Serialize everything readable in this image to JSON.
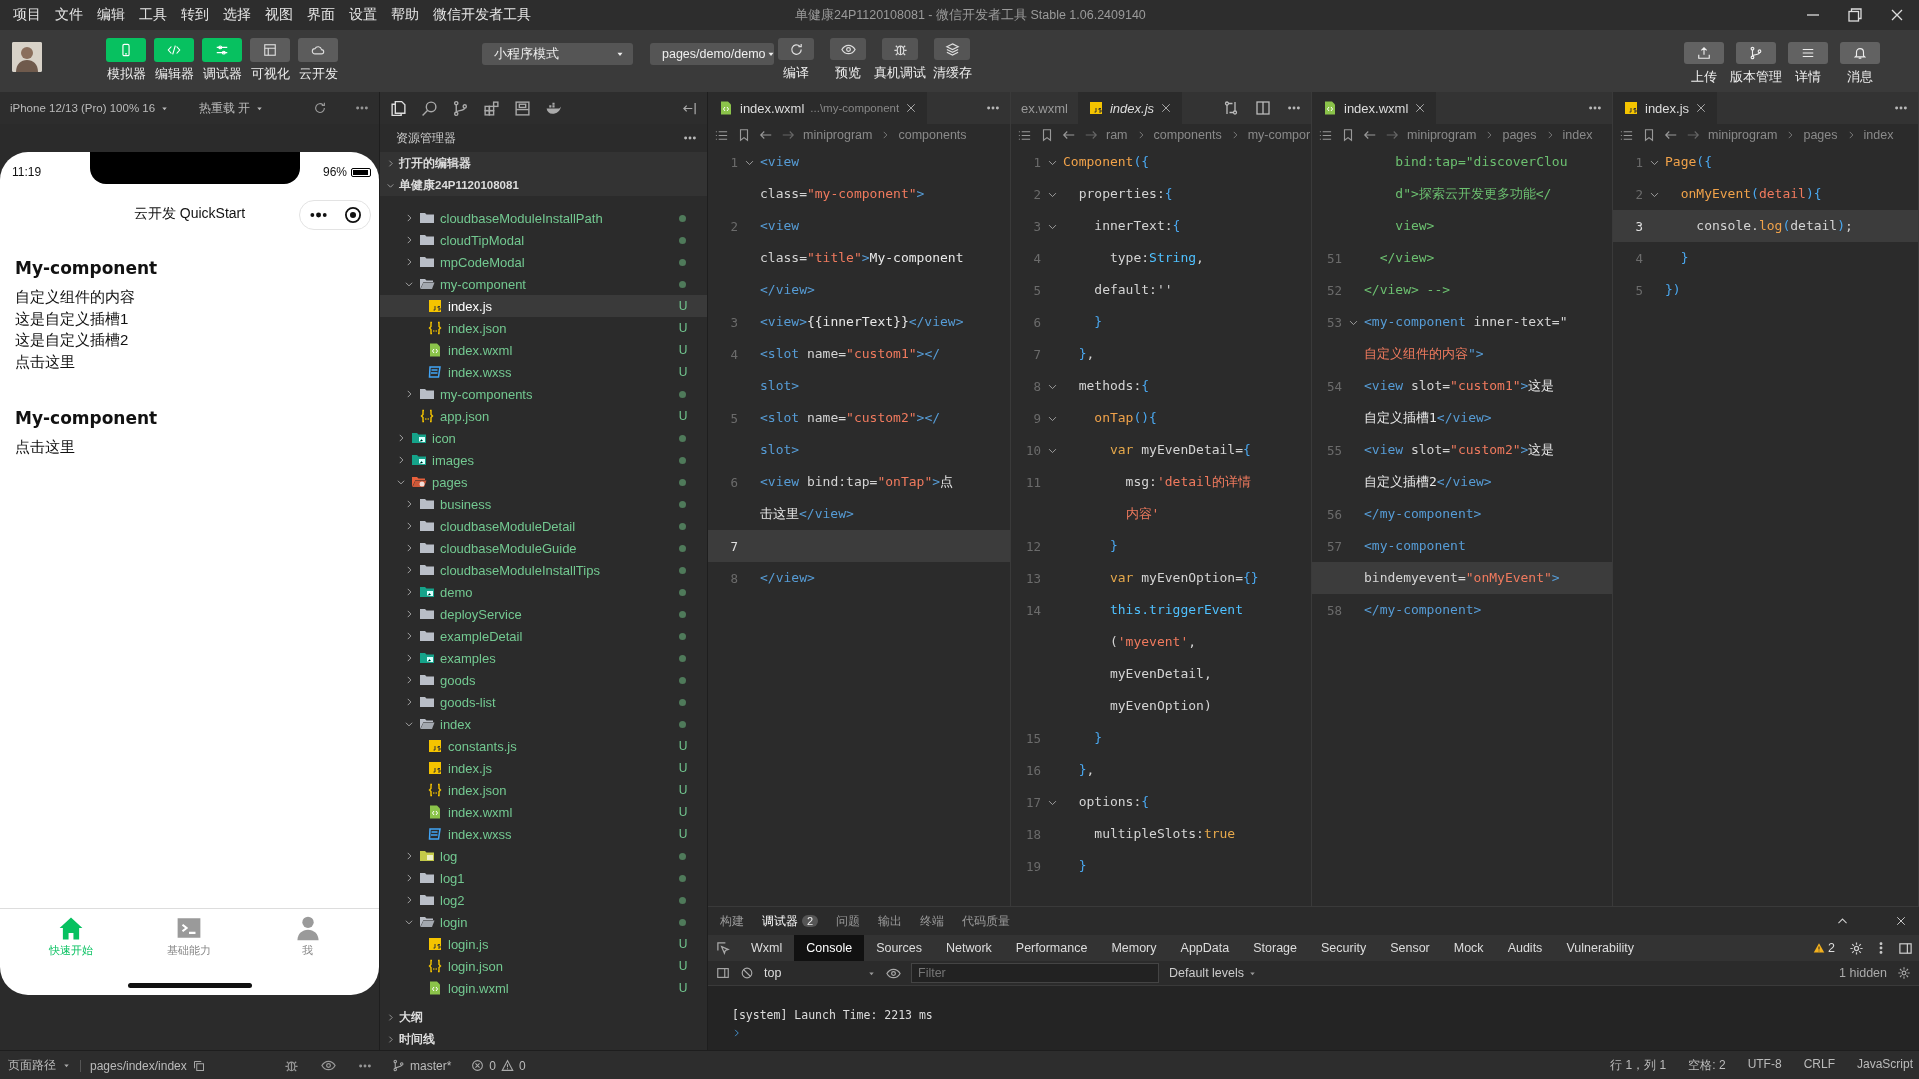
{
  "menu": [
    "项目",
    "文件",
    "编辑",
    "工具",
    "转到",
    "选择",
    "视图",
    "界面",
    "设置",
    "帮助",
    "微信开发者工具"
  ],
  "window": {
    "title": "单健康24P1120108081 - 微信开发者工具 Stable 1.06.2409140"
  },
  "toolbar": {
    "view_buttons": [
      {
        "label": "模拟器",
        "kind": "phone",
        "on": true
      },
      {
        "label": "编辑器",
        "kind": "code",
        "on": true
      },
      {
        "label": "调试器",
        "kind": "sliders",
        "on": true
      },
      {
        "label": "可视化",
        "kind": "layout",
        "on": false
      },
      {
        "label": "云开发",
        "kind": "cloud",
        "on": false
      }
    ],
    "mode": "小程序模式",
    "compile_page": "pages/demo/demo",
    "actions": [
      {
        "label": "编译",
        "kind": "refresh"
      },
      {
        "label": "预览",
        "kind": "eye"
      },
      {
        "label": "真机调试",
        "kind": "bug"
      },
      {
        "label": "清缓存",
        "kind": "layers"
      }
    ],
    "right_buttons": [
      {
        "label": "上传",
        "kind": "upload"
      },
      {
        "label": "版本管理",
        "kind": "branch"
      },
      {
        "label": "详情",
        "kind": "menu"
      },
      {
        "label": "消息",
        "kind": "bell"
      }
    ]
  },
  "simulator": {
    "device": "iPhone 12/13 (Pro) 100% 16",
    "hot_reload": "热重载 开",
    "time": "11:19",
    "battery": "96%",
    "nav_title": "云开发 QuickStart",
    "blocks": [
      {
        "heading": "My-component",
        "lines": [
          "自定义组件的内容",
          "这是自定义插槽1",
          "这是自定义插槽2",
          "点击这里"
        ]
      },
      {
        "heading": "My-component",
        "lines": [
          "点击这里"
        ]
      }
    ],
    "tabbar": [
      {
        "label": "快速开始",
        "kind": "home",
        "selected": true
      },
      {
        "label": "基础能力",
        "kind": "terminal",
        "selected": false
      },
      {
        "label": "我",
        "kind": "person",
        "selected": false
      }
    ]
  },
  "explorer": {
    "title": "资源管理器",
    "sections": [
      {
        "label": "打开的编辑器",
        "expanded": false
      },
      {
        "label": "单健康24P1120108081",
        "expanded": true
      }
    ],
    "tree": [
      {
        "children": [
          {
            "label": "cloudbaseModuleInstallPath",
            "kind": "folder",
            "expanded": false,
            "selected": false
          },
          {
            "label": "cloudTipModal",
            "kind": "folder",
            "expanded": false,
            "selected": false
          },
          {
            "label": "mpCodeModal",
            "kind": "folder",
            "expanded": false,
            "selected": false
          },
          {
            "label": "my-component",
            "kind": "folder",
            "expanded": true,
            "selected": false,
            "children": [
              {
                "label": "index.js",
                "kind": "js",
                "badge": "U",
                "selected": true
              },
              {
                "label": "index.json",
                "kind": "json",
                "badge": "U",
                "selected": false
              },
              {
                "label": "index.wxml",
                "kind": "wxml",
                "badge": "U",
                "selected": false
              },
              {
                "label": "index.wxss",
                "kind": "wxss",
                "badge": "U",
                "selected": false
              }
            ]
          },
          {
            "label": "my-components",
            "kind": "folder",
            "expanded": false,
            "selected": false
          },
          {
            "label": "app.json",
            "kind": "json",
            "badge": "U",
            "selected": false
          }
        ]
      },
      {
        "label": "icon",
        "kind": "folder-image",
        "expanded": false,
        "selected": false
      },
      {
        "label": "images",
        "kind": "folder-image",
        "expanded": false,
        "selected": false
      },
      {
        "label": "pages",
        "kind": "folder-pages",
        "expanded": true,
        "selected": false,
        "children": [
          {
            "label": "business",
            "kind": "folder",
            "expanded": false,
            "selected": false
          },
          {
            "label": "cloudbaseModuleDetail",
            "kind": "folder",
            "expanded": false,
            "selected": false
          },
          {
            "label": "cloudbaseModuleGuide",
            "kind": "folder",
            "expanded": false,
            "selected": false
          },
          {
            "label": "cloudbaseModuleInstallTips",
            "kind": "folder",
            "expanded": false,
            "selected": false
          },
          {
            "label": "demo",
            "kind": "folder-image",
            "expanded": false,
            "selected": false
          },
          {
            "label": "deployService",
            "kind": "folder",
            "expanded": false,
            "selected": false
          },
          {
            "label": "exampleDetail",
            "kind": "folder",
            "expanded": false,
            "selected": false
          },
          {
            "label": "examples",
            "kind": "folder-image",
            "expanded": false,
            "selected": false
          },
          {
            "label": "goods",
            "kind": "folder",
            "expanded": false,
            "selected": false
          },
          {
            "label": "goods-list",
            "kind": "folder",
            "expanded": false,
            "selected": false
          },
          {
            "label": "index",
            "kind": "folder",
            "expanded": true,
            "selected": false,
            "children": [
              {
                "label": "constants.js",
                "kind": "js",
                "badge": "U",
                "selected": false
              },
              {
                "label": "index.js",
                "kind": "js",
                "badge": "U",
                "selected": false
              },
              {
                "label": "index.json",
                "kind": "json",
                "badge": "U",
                "selected": false
              },
              {
                "label": "index.wxml",
                "kind": "wxml",
                "badge": "U",
                "selected": false
              },
              {
                "label": "index.wxss",
                "kind": "wxss",
                "badge": "U",
                "selected": false
              }
            ]
          },
          {
            "label": "log",
            "kind": "folder-log",
            "expanded": false,
            "selected": false
          },
          {
            "label": "log1",
            "kind": "folder",
            "expanded": false,
            "selected": false
          },
          {
            "label": "log2",
            "kind": "folder",
            "expanded": false,
            "selected": false
          },
          {
            "label": "login",
            "kind": "folder",
            "expanded": true,
            "selected": false,
            "children": [
              {
                "label": "login.js",
                "kind": "js",
                "badge": "U",
                "selected": false
              },
              {
                "label": "login.json",
                "kind": "json",
                "badge": "U",
                "selected": false
              },
              {
                "label": "login.wxml",
                "kind": "wxml",
                "badge": "U",
                "selected": false
              }
            ]
          }
        ]
      }
    ],
    "bottom_sections": [
      {
        "label": "大纲",
        "expanded": false
      },
      {
        "label": "时间线",
        "expanded": false
      }
    ]
  },
  "editors": [
    {
      "focused": false,
      "tabs": [
        {
          "label": "index.wxml",
          "description": "...\\my-component",
          "kind": "wxml",
          "selected": true,
          "preview": false
        }
      ],
      "breadcrumb": [
        "miniprogram",
        "components"
      ],
      "rows": [
        {
          "number": "1",
          "fold": true,
          "tokens": [
            {
              "kind": "tag",
              "text": "<view"
            }
          ]
        },
        {
          "tokens": [
            {
              "kind": "attr",
              "text": "class="
            },
            {
              "kind": "string",
              "text": "\"my-component\""
            },
            {
              "kind": "tag",
              "text": ">"
            }
          ]
        },
        {
          "number": "2",
          "tokens": [
            {
              "kind": "tag",
              "text": "<view"
            }
          ]
        },
        {
          "tokens": [
            {
              "kind": "attr",
              "text": "class="
            },
            {
              "kind": "string",
              "text": "\"title\""
            },
            {
              "kind": "tag",
              "text": ">"
            },
            {
              "kind": "text",
              "text": "My-component"
            }
          ]
        },
        {
          "tokens": [
            {
              "kind": "tag",
              "text": "</view>"
            }
          ]
        },
        {
          "number": "3",
          "tokens": [
            {
              "kind": "tag",
              "text": "<view>"
            },
            {
              "kind": "text",
              "text": "{{innerText}}"
            },
            {
              "kind": "tag",
              "text": "</view>"
            }
          ]
        },
        {
          "number": "4",
          "tokens": [
            {
              "kind": "tag",
              "text": "<slot"
            },
            {
              "kind": "attr",
              "text": " name="
            },
            {
              "kind": "string",
              "text": "\"custom1\""
            },
            {
              "kind": "tag",
              "text": "></"
            }
          ]
        },
        {
          "tokens": [
            {
              "kind": "tag",
              "text": "slot>"
            }
          ]
        },
        {
          "number": "5",
          "tokens": [
            {
              "kind": "tag",
              "text": "<slot"
            },
            {
              "kind": "attr",
              "text": " name="
            },
            {
              "kind": "string",
              "text": "\"custom2\""
            },
            {
              "kind": "tag",
              "text": "></"
            }
          ]
        },
        {
          "tokens": [
            {
              "kind": "tag",
              "text": "slot>"
            }
          ]
        },
        {
          "number": "6",
          "tokens": [
            {
              "kind": "tag",
              "text": "<view"
            },
            {
              "kind": "attr",
              "text": " bind:tap="
            },
            {
              "kind": "string",
              "text": "\"onTap\""
            },
            {
              "kind": "tag",
              "text": ">"
            },
            {
              "kind": "text",
              "text": "点"
            }
          ]
        },
        {
          "tokens": [
            {
              "kind": "text",
              "text": "击这里"
            },
            {
              "kind": "tag",
              "text": "</view>"
            }
          ]
        },
        {
          "number": "7",
          "current": true,
          "tokens": []
        },
        {
          "number": "8",
          "tokens": [
            {
              "kind": "tag",
              "text": "</view>"
            }
          ]
        }
      ]
    },
    {
      "focused": true,
      "tabs": [
        {
          "label": "ex.wxml",
          "selected": false,
          "preview": false
        },
        {
          "label": "index.js",
          "kind": "js",
          "selected": true,
          "preview": true
        }
      ],
      "breadcrumb": [
        "ram",
        "components",
        "my-compor"
      ],
      "rows": [
        {
          "number": "1",
          "fold": true,
          "tokens": [
            {
              "kind": "function",
              "text": "Component"
            },
            {
              "kind": "bracket",
              "text": "({"
            }
          ]
        },
        {
          "number": "2",
          "fold": true,
          "tokens": [
            {
              "kind": "plain",
              "text": "  properties:"
            },
            {
              "kind": "bracket",
              "text": "{"
            }
          ]
        },
        {
          "number": "3",
          "fold": true,
          "tokens": [
            {
              "kind": "plain",
              "text": "    innerText:"
            },
            {
              "kind": "bracket",
              "text": "{"
            }
          ]
        },
        {
          "number": "4",
          "tokens": [
            {
              "kind": "plain",
              "text": "      type:"
            },
            {
              "kind": "type",
              "text": "String"
            },
            {
              "kind": "plain",
              "text": ","
            }
          ]
        },
        {
          "number": "5",
          "tokens": [
            {
              "kind": "plain",
              "text": "    default:''"
            }
          ]
        },
        {
          "number": "6",
          "tokens": [
            {
              "kind": "bracket",
              "text": "    }"
            }
          ]
        },
        {
          "number": "7",
          "tokens": [
            {
              "kind": "bracket",
              "text": "  }"
            },
            {
              "kind": "plain",
              "text": ","
            }
          ]
        },
        {
          "number": "8",
          "fold": true,
          "tokens": [
            {
              "kind": "plain",
              "text": "  methods:"
            },
            {
              "kind": "bracket",
              "text": "{"
            }
          ]
        },
        {
          "number": "9",
          "fold": true,
          "tokens": [
            {
              "kind": "function",
              "text": "    onTap"
            },
            {
              "kind": "bracket",
              "text": "(){"
            }
          ]
        },
        {
          "number": "10",
          "fold": true,
          "tokens": [
            {
              "kind": "keyword",
              "text": "      var"
            },
            {
              "kind": "plain",
              "text": " myEvenDetail="
            },
            {
              "kind": "bracket",
              "text": "{"
            }
          ]
        },
        {
          "number": "11",
          "tokens": [
            {
              "kind": "plain",
              "text": "        msg:"
            },
            {
              "kind": "string",
              "text": "'detail的详情"
            }
          ]
        },
        {
          "tokens": [
            {
              "kind": "string",
              "text": "        内容'"
            }
          ]
        },
        {
          "number": "12",
          "tokens": [
            {
              "kind": "bracket",
              "text": "      }"
            }
          ]
        },
        {
          "number": "13",
          "tokens": [
            {
              "kind": "keyword",
              "text": "      var"
            },
            {
              "kind": "plain",
              "text": " myEvenOption="
            },
            {
              "kind": "bracket",
              "text": "{}"
            }
          ]
        },
        {
          "number": "14",
          "tokens": [
            {
              "kind": "type",
              "text": "      this.triggerEvent"
            }
          ]
        },
        {
          "tokens": [
            {
              "kind": "plain",
              "text": "      ("
            },
            {
              "kind": "string",
              "text": "'myevent'"
            },
            {
              "kind": "plain",
              "text": ","
            }
          ]
        },
        {
          "tokens": [
            {
              "kind": "plain",
              "text": "      myEvenDetail,"
            }
          ]
        },
        {
          "tokens": [
            {
              "kind": "plain",
              "text": "      myEvenOption)"
            }
          ]
        },
        {
          "number": "15",
          "tokens": [
            {
              "kind": "bracket",
              "text": "    }"
            }
          ]
        },
        {
          "number": "16",
          "tokens": [
            {
              "kind": "bracket",
              "text": "  }"
            },
            {
              "kind": "plain",
              "text": ","
            }
          ]
        },
        {
          "number": "17",
          "fold": true,
          "tokens": [
            {
              "kind": "plain",
              "text": "  options:"
            },
            {
              "kind": "bracket",
              "text": "{"
            }
          ]
        },
        {
          "number": "18",
          "tokens": [
            {
              "kind": "plain",
              "text": "    multipleSlots:"
            },
            {
              "kind": "keyword",
              "text": "true"
            }
          ]
        },
        {
          "number": "19",
          "tokens": [
            {
              "kind": "bracket",
              "text": "  }"
            }
          ]
        }
      ]
    },
    {
      "focused": false,
      "tabs": [
        {
          "label": "index.wxml",
          "kind": "wxml",
          "selected": true,
          "preview": false
        }
      ],
      "breadcrumb": [
        "miniprogram",
        "pages",
        "index"
      ],
      "rows": [
        {
          "tokens": [
            {
              "kind": "comment",
              "text": "    bind:tap=\"discoverClou"
            }
          ]
        },
        {
          "tokens": [
            {
              "kind": "comment",
              "text": "    d\">探索云开发更多功能</"
            }
          ]
        },
        {
          "tokens": [
            {
              "kind": "comment",
              "text": "    view>"
            }
          ]
        },
        {
          "number": "51",
          "tokens": [
            {
              "kind": "comment",
              "text": "  </view>"
            }
          ]
        },
        {
          "number": "52",
          "tokens": [
            {
              "kind": "comment",
              "text": "</view> -->"
            }
          ]
        },
        {
          "number": "53",
          "fold": true,
          "tokens": [
            {
              "kind": "tag",
              "text": "<my-component"
            },
            {
              "kind": "attr",
              "text": " inner-text=\""
            }
          ]
        },
        {
          "tokens": [
            {
              "kind": "string",
              "text": "自定义组件的内容"
            },
            {
              "kind": "tag",
              "text": "\">"
            }
          ]
        },
        {
          "number": "54",
          "tokens": [
            {
              "kind": "tag",
              "text": "<view"
            },
            {
              "kind": "attr",
              "text": " slot="
            },
            {
              "kind": "string",
              "text": "\"custom1\""
            },
            {
              "kind": "tag",
              "text": ">"
            },
            {
              "kind": "text",
              "text": "这是"
            }
          ]
        },
        {
          "tokens": [
            {
              "kind": "text",
              "text": "自定义插槽1"
            },
            {
              "kind": "tag",
              "text": "</view>"
            }
          ]
        },
        {
          "number": "55",
          "tokens": [
            {
              "kind": "tag",
              "text": "<view"
            },
            {
              "kind": "attr",
              "text": " slot="
            },
            {
              "kind": "string",
              "text": "\"custom2\""
            },
            {
              "kind": "tag",
              "text": ">"
            },
            {
              "kind": "text",
              "text": "这是"
            }
          ]
        },
        {
          "tokens": [
            {
              "kind": "text",
              "text": "自定义插槽2"
            },
            {
              "kind": "tag",
              "text": "</view>"
            }
          ]
        },
        {
          "number": "56",
          "tokens": [
            {
              "kind": "tag",
              "text": "</my-component>"
            }
          ]
        },
        {
          "number": "57",
          "tokens": [
            {
              "kind": "tag",
              "text": "<my-component"
            }
          ]
        },
        {
          "current": true,
          "tokens": [
            {
              "kind": "attr",
              "text": "bindemyevent="
            },
            {
              "kind": "string",
              "text": "\"onMyEvent\""
            },
            {
              "kind": "tag",
              "text": ">"
            }
          ]
        },
        {
          "number": "58",
          "tokens": [
            {
              "kind": "tag",
              "text": "</my-component>"
            }
          ]
        }
      ]
    },
    {
      "focused": false,
      "tabs": [
        {
          "label": "index.js",
          "kind": "js",
          "selected": true,
          "preview": false
        }
      ],
      "breadcrumb": [
        "miniprogram",
        "pages",
        "index"
      ],
      "rows": [
        {
          "number": "1",
          "fold": true,
          "tokens": [
            {
              "kind": "function",
              "text": "Page"
            },
            {
              "kind": "bracket",
              "text": "({"
            }
          ]
        },
        {
          "number": "2",
          "fold": true,
          "tokens": [
            {
              "kind": "function",
              "text": "  onMyEvent"
            },
            {
              "kind": "bracket",
              "text": "("
            },
            {
              "kind": "string",
              "text": "detail"
            },
            {
              "kind": "bracket",
              "text": "){"
            }
          ]
        },
        {
          "number": "3",
          "current": true,
          "tokens": [
            {
              "kind": "plain",
              "text": "    console."
            },
            {
              "kind": "function",
              "text": "log"
            },
            {
              "kind": "bracket",
              "text": "("
            },
            {
              "kind": "plain",
              "text": "detail"
            },
            {
              "kind": "bracket",
              "text": ")"
            },
            {
              "kind": "plain",
              "text": ";"
            }
          ]
        },
        {
          "number": "4",
          "tokens": [
            {
              "kind": "bracket",
              "text": "  }"
            }
          ]
        },
        {
          "number": "5",
          "tokens": [
            {
              "kind": "bracket",
              "text": "})"
            }
          ]
        }
      ]
    }
  ],
  "panel": {
    "tabs": [
      {
        "label": "构建",
        "selected": false
      },
      {
        "label": "调试器",
        "selected": true,
        "badge": "2"
      },
      {
        "label": "问题",
        "selected": false
      },
      {
        "label": "输出",
        "selected": false
      },
      {
        "label": "终端",
        "selected": false
      },
      {
        "label": "代码质量",
        "selected": false
      }
    ],
    "devtools_tabs": [
      {
        "label": "Wxml",
        "selected": false
      },
      {
        "label": "Console",
        "selected": true
      },
      {
        "label": "Sources",
        "selected": false
      },
      {
        "label": "Network",
        "selected": false
      },
      {
        "label": "Performance",
        "selected": false
      },
      {
        "label": "Memory",
        "selected": false
      },
      {
        "label": "AppData",
        "selected": false
      },
      {
        "label": "Storage",
        "selected": false
      },
      {
        "label": "Security",
        "selected": false
      },
      {
        "label": "Sensor",
        "selected": false
      },
      {
        "label": "Mock",
        "selected": false
      },
      {
        "label": "Audits",
        "selected": false
      },
      {
        "label": "Vulnerability",
        "selected": false
      }
    ],
    "warnings": "2",
    "context": "top",
    "filter_placeholder": "Filter",
    "levels": "Default levels",
    "hidden": "1 hidden",
    "console_lines": [
      "[system] Launch Time: 2213 ms"
    ]
  },
  "status_bar": {
    "page_path_label": "页面路径",
    "page_path": "pages/index/index",
    "branch": "master*",
    "errors": "0",
    "warnings": "0",
    "items": [
      "行 1，列 1",
      "空格: 2",
      "UTF-8",
      "CRLF",
      "JavaScript"
    ]
  }
}
